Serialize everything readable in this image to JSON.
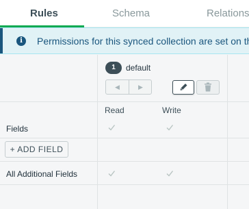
{
  "tabs": [
    {
      "label": "Rules",
      "active": true
    },
    {
      "label": "Schema",
      "active": false
    },
    {
      "label": "Relations",
      "active": false
    }
  ],
  "banner": {
    "icon": "info-icon",
    "text": "Permissions for this synced collection are set on the"
  },
  "role": {
    "badge": "1",
    "name": "default",
    "move_left_icon": "◀",
    "move_right_icon": "▶"
  },
  "columns": {
    "read": "Read",
    "write": "Write"
  },
  "rows": {
    "fields_label": "Fields",
    "add_field_label": "+ ADD FIELD",
    "additional_fields_label": "All Additional Fields"
  },
  "colors": {
    "accent": "#13aa52",
    "banner_bg": "#e1f2f6",
    "banner_text": "#1a567e",
    "check": "#b8c4c2"
  }
}
